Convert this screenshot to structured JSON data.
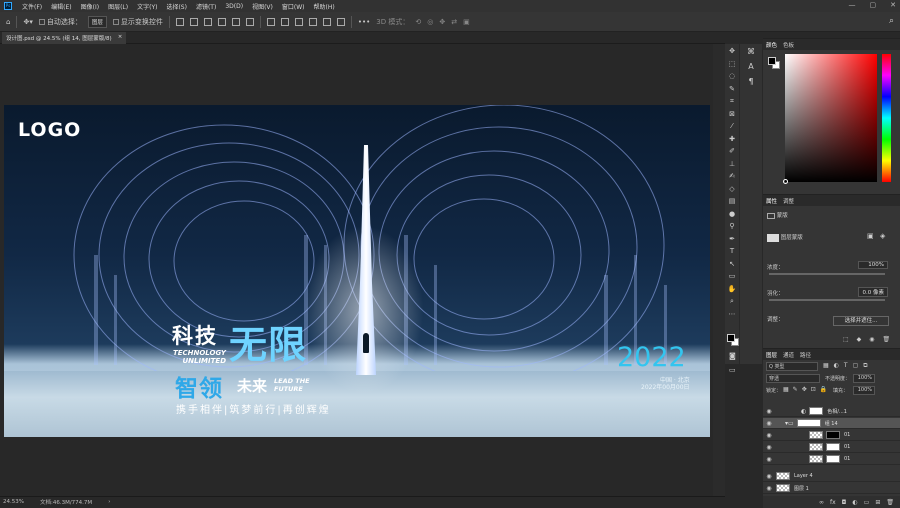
{
  "app": {
    "logo": "Ps"
  },
  "menubar": {
    "items": [
      "文件(F)",
      "编辑(E)",
      "图像(I)",
      "图层(L)",
      "文字(Y)",
      "选择(S)",
      "滤镜(T)",
      "3D(D)",
      "视图(V)",
      "窗口(W)",
      "帮助(H)"
    ]
  },
  "window_controls": {
    "minimize": "—",
    "maximize": "▢",
    "close": "✕"
  },
  "options": {
    "auto_select_label": "自动选择：",
    "auto_select_value": "图层",
    "show_transform_label": "显示变换控件",
    "mode_label": "3D 模式："
  },
  "document": {
    "tab_title": "设计图.psd @ 24.5% (组 14, 图层蒙版/8)",
    "close": "×"
  },
  "canvas": {
    "logo": "LOGO",
    "title_a": "科技",
    "title_b": "无限",
    "tech_line1": "TECHNOLOGY",
    "tech_line2": "UNLIMITED",
    "sub_a": "智领",
    "sub_b": "未来",
    "lead_line1": "LEAD THE",
    "lead_line2": "FUTURE",
    "slogan": "携手相伴|筑梦前行|再创辉煌",
    "year": "2022",
    "location": "中国 · 北京",
    "date": "2022年00月00日"
  },
  "statusbar": {
    "zoom": "24.53%",
    "doc_size": "文档:46.3M/774.7M",
    "arrow": "›"
  },
  "color_panel": {
    "tabs": [
      "颜色",
      "色板"
    ]
  },
  "props_panel": {
    "tabs": [
      "属性",
      "调整"
    ],
    "section": "蒙版",
    "mask_label": "图层蒙版",
    "density_label": "浓度：",
    "density_value": "100%",
    "feather_label": "羽化：",
    "feather_value": "0.0 像素",
    "refine_label": "调整：",
    "select_mask_button": "选择并遮住..."
  },
  "layers_panel": {
    "tabs": [
      "图层",
      "通道",
      "路径"
    ],
    "filter_label": "Q 类型",
    "blend_mode": "穿透",
    "opacity_label": "不透明度：",
    "opacity_value": "100%",
    "lock_label": "锁定：",
    "fill_label": "填充：",
    "fill_value": "100%",
    "layers": [
      {
        "name": "色相/...1"
      },
      {
        "name": "组 14"
      },
      {
        "name": "01"
      },
      {
        "name": "01"
      },
      {
        "name": "01"
      },
      {
        "name": "Layer 4"
      },
      {
        "name": "图层 1"
      }
    ]
  }
}
